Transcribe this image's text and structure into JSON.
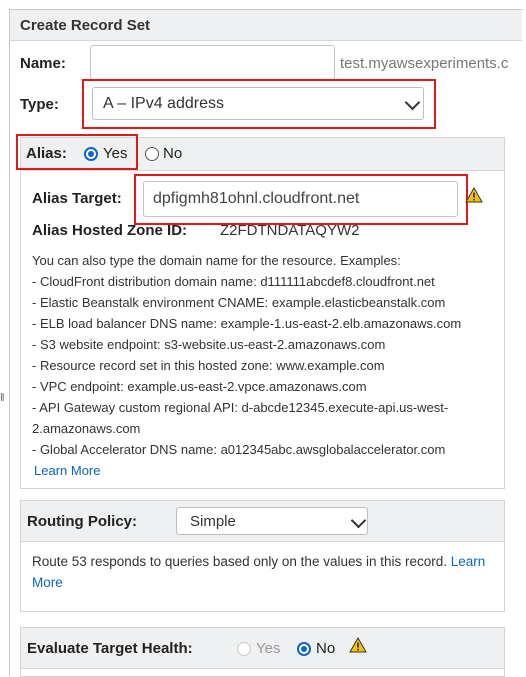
{
  "header": {
    "title": "Create Record Set"
  },
  "name": {
    "label": "Name:",
    "value": "",
    "suffix": "test.myawsexperiments.c"
  },
  "type": {
    "label": "Type:",
    "selected": "A – IPv4 address"
  },
  "alias": {
    "label": "Alias:",
    "yes_label": "Yes",
    "no_label": "No",
    "selected": "Yes"
  },
  "alias_target": {
    "label": "Alias Target:",
    "value": "dpfigmh81ohnl.cloudfront.net"
  },
  "hosted_zone": {
    "label": "Alias Hosted Zone ID:",
    "value": "Z2FDTNDATAQYW2"
  },
  "examples": {
    "intro": "You can also type the domain name for the resource. Examples:",
    "lines": [
      "-  CloudFront distribution domain name: d111111abcdef8.cloudfront.net",
      "-  Elastic Beanstalk environment CNAME: example.elasticbeanstalk.com",
      "-  ELB load balancer DNS name: example-1.us-east-2.elb.amazonaws.com",
      "-  S3 website endpoint: s3-website.us-east-2.amazonaws.com",
      "-  Resource record set in this hosted zone: www.example.com",
      "-  VPC endpoint: example.us-east-2.vpce.amazonaws.com",
      "-  API Gateway custom regional API: d-abcde12345.execute-api.us-west-",
      "2.amazonaws.com",
      "-  Global Accelerator DNS name: a012345abc.awsglobalaccelerator.com"
    ],
    "learn_more": "Learn More"
  },
  "routing": {
    "label": "Routing Policy:",
    "selected": "Simple",
    "description": "Route 53 responds to queries based only on the values in this record.",
    "learn_more_1": "Learn",
    "learn_more_2": "More"
  },
  "health": {
    "label": "Evaluate Target Health:",
    "yes_label": "Yes",
    "no_label": "No",
    "selected": "No"
  },
  "colors": {
    "accent": "#0a66d6",
    "highlight": "#e01a1a",
    "link": "#0a66c2",
    "warning": "#f5c400"
  },
  "icons": [
    "chevron-down-icon",
    "warning-icon",
    "resize-grip-icon"
  ]
}
